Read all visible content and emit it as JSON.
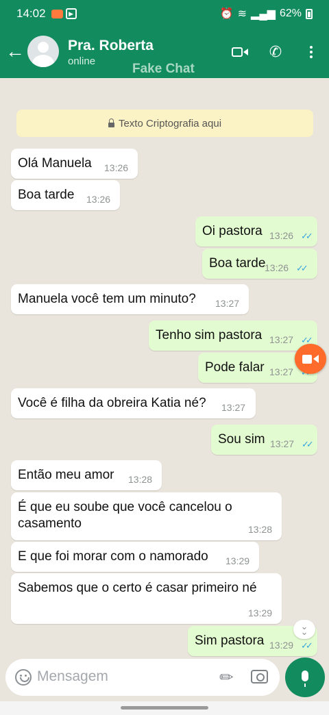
{
  "status_bar": {
    "time": "14:02",
    "battery": "62%"
  },
  "header": {
    "back_icon": "arrow-left-icon",
    "contact_name": "Pra. Roberta",
    "contact_status": "online",
    "watermark": "Fake Chat",
    "actions": [
      "video-call-icon",
      "phone-icon",
      "more-vert-icon"
    ],
    "color": "#128c5e"
  },
  "encryption_notice": "Texto Criptografia aqui",
  "messages": [
    {
      "dir": "in",
      "text": "Olá Manuela",
      "time": "13:26"
    },
    {
      "dir": "in",
      "text": "Boa tarde",
      "time": "13:26"
    },
    {
      "dir": "out",
      "text": "Oi pastora",
      "time": "13:26",
      "read": true
    },
    {
      "dir": "out",
      "text": "Boa tarde",
      "time": "13:26",
      "read": true
    },
    {
      "dir": "in",
      "text": "Manuela você tem um minuto?",
      "time": "13:27"
    },
    {
      "dir": "out",
      "text": "Tenho sim pastora",
      "time": "13:27",
      "read": true
    },
    {
      "dir": "out",
      "text": "Pode falar",
      "time": "13:27",
      "read": true
    },
    {
      "dir": "in",
      "text": "Você é filha da obreira Katia né?",
      "time": "13:27"
    },
    {
      "dir": "out",
      "text": "Sou sim",
      "time": "13:27",
      "read": true
    },
    {
      "dir": "in",
      "text": "Então meu amor",
      "time": "13:28"
    },
    {
      "dir": "in",
      "text": "É que eu soube que você cancelou o\ncasamento",
      "time": "13:28"
    },
    {
      "dir": "in",
      "text": "E que foi morar com o namorado",
      "time": "13:29"
    },
    {
      "dir": "in",
      "text": "Sabemos que o certo é casar primeiro né",
      "time": "13:29"
    },
    {
      "dir": "out",
      "text": "Sim pastora",
      "time": "13:29",
      "read": true
    }
  ],
  "composer": {
    "placeholder": "Mensagem",
    "icons": [
      "emoji-icon",
      "attach-icon",
      "camera-icon",
      "mic-icon"
    ]
  },
  "colors": {
    "incoming": "#ffffff",
    "outgoing": "#e3fbd0",
    "read_ticks": "#35a6de",
    "fab": "#ff6b2a"
  }
}
